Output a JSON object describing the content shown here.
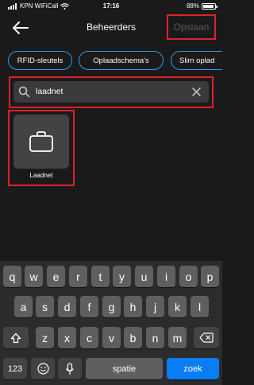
{
  "status_bar": {
    "carrier": "KPN WiFiCall",
    "time": "17:16",
    "battery": "88%"
  },
  "header": {
    "title": "Beheerders",
    "save_label": "Opslaan"
  },
  "chips": [
    "RFID-sleutels",
    "Oplaadschema's",
    "Slim oplad"
  ],
  "search": {
    "value": "laadnet"
  },
  "results": [
    {
      "label": "Laadnet"
    }
  ],
  "keyboard": {
    "row1": [
      "q",
      "w",
      "e",
      "r",
      "t",
      "y",
      "u",
      "i",
      "o",
      "p"
    ],
    "row2": [
      "a",
      "s",
      "d",
      "f",
      "g",
      "h",
      "j",
      "k",
      "l"
    ],
    "row3": [
      "z",
      "x",
      "c",
      "v",
      "b",
      "n",
      "m"
    ],
    "numbers_label": "123",
    "space_label": "spatie",
    "search_label": "zoek"
  },
  "colors": {
    "background": "#1a1a1a",
    "accent": "#2c9cf0",
    "highlight": "#e0202a",
    "key_blue": "#0a7cf5"
  }
}
